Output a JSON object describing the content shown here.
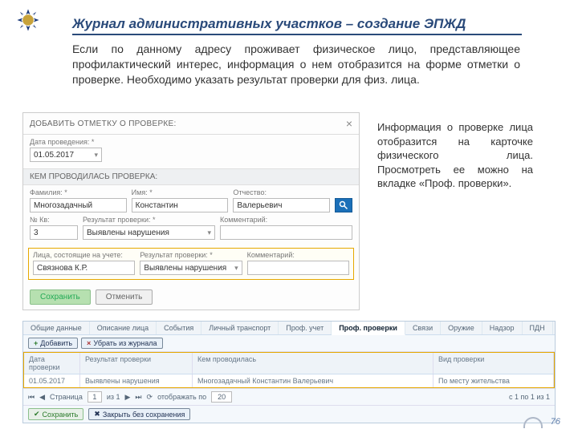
{
  "page": {
    "title": "Журнал административных участков – создание ЭПЖД",
    "intro": "Если по данному адресу проживает физическое лицо, представляющее профилактический интерес, информация о нем отобразится на форме отметки о проверке. Необходимо указать результат проверки для физ. лица.",
    "side_note": "Информация о проверке лица отобразится на карточке физического лица. Просмотреть ее можно на вкладке «Проф. проверки».",
    "page_number": "76"
  },
  "modal": {
    "title": "ДОБАВИТЬ ОТМЕТКУ О ПРОВЕРКЕ:",
    "date_label": "Дата проведения: *",
    "date_value": "01.05.2017",
    "who_section": "КЕМ ПРОВОДИЛАСЬ ПРОВЕРКА:",
    "surname_label": "Фамилия: *",
    "surname_value": "Многозадачный",
    "name_label": "Имя: *",
    "name_value": "Константин",
    "patr_label": "Отчество:",
    "patr_value": "Валерьевич",
    "nkv_label": "№ Кв:",
    "nkv_value": "3",
    "result_label": "Результат проверки: *",
    "result_value": "Выявлены нарушения",
    "comment_label": "Комментарий:",
    "comment_value": "",
    "persons_label": "Лица, состоящие на учете:",
    "person_value": "Связнова К.Р.",
    "p_result_label": "Результат проверки: *",
    "p_result_value": "Выявлены нарушения",
    "p_comment_label": "Комментарий:",
    "p_comment_value": "",
    "save": "Сохранить",
    "cancel": "Отменить"
  },
  "card": {
    "tabs": [
      "Общие данные",
      "Описание лица",
      "События",
      "Личный транспорт",
      "Проф. учет",
      "Проф. проверки",
      "Связи",
      "Оружие",
      "Надзор",
      "ПДН"
    ],
    "add": "Добавить",
    "clear": "Убрать из журнала",
    "col_date": "Дата проверки",
    "col_result": "Результат проверки",
    "col_who": "Кем проводилась",
    "col_kind": "Вид проверки",
    "row_date": "01.05.2017",
    "row_result": "Выявлены нарушения",
    "row_who": "Многозадачный Константин Валерьевич",
    "row_kind": "По месту жительства",
    "pager_page_lbl": "Страница",
    "pager_page": "1",
    "pager_of": "из 1",
    "pager_show": "отображать по",
    "pager_size": "20",
    "pager_summary": "с 1 по 1 из 1",
    "save": "Сохранить",
    "close_nosave": "Закрыть без сохранения"
  }
}
